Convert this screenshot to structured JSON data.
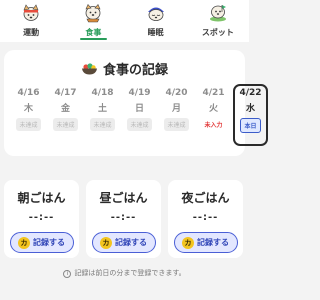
{
  "tabs": [
    {
      "label": "運動",
      "icon": "dog-exercise-icon",
      "active": false
    },
    {
      "label": "食事",
      "icon": "dog-meal-icon",
      "active": true
    },
    {
      "label": "睡眠",
      "icon": "dog-sleep-icon",
      "active": false
    },
    {
      "label": "スポット",
      "icon": "dog-spot-icon",
      "active": false
    }
  ],
  "record": {
    "title": "食事の記録",
    "days": [
      {
        "date": "4/16",
        "weekday": "木",
        "status": "未達成"
      },
      {
        "date": "4/17",
        "weekday": "金",
        "status": "未達成"
      },
      {
        "date": "4/18",
        "weekday": "土",
        "status": "未達成"
      },
      {
        "date": "4/19",
        "weekday": "日",
        "status": "未達成"
      },
      {
        "date": "4/20",
        "weekday": "月",
        "status": "未達成"
      },
      {
        "date": "4/21",
        "weekday": "火",
        "status": "未入力"
      },
      {
        "date": "4/22",
        "weekday": "水",
        "status": "本日"
      }
    ]
  },
  "meals": [
    {
      "name": "朝ごはん",
      "time": "--:--",
      "button": "記録する",
      "coin": "カ"
    },
    {
      "name": "昼ごはん",
      "time": "--:--",
      "button": "記録する",
      "coin": "カ"
    },
    {
      "name": "夜ごはん",
      "time": "--:--",
      "button": "記録する",
      "coin": "カ"
    }
  ],
  "note": "記録は前日の分まで登録できます。",
  "note_icon": "i",
  "colors": {
    "accent": "#2a9d5a",
    "button": "#4a5fd6",
    "warn": "#e33b3b",
    "coin": "#f3c51f"
  }
}
